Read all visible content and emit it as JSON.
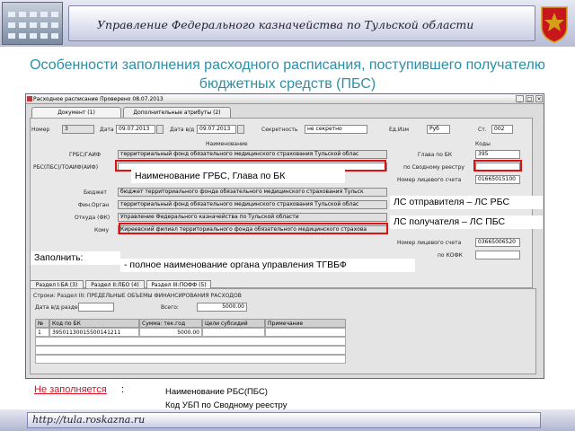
{
  "header": {
    "org_title": "Управление Федерального казначейства по Тульской области"
  },
  "slide_title": "Особенности заполнения расходного расписания, поступившего получателю бюджетных средств (ПБС)",
  "window": {
    "title": "Расходное расписание Проверено 08.07.2013",
    "tabs": [
      "Документ (1)",
      "Дополнительные атрибуты (2)"
    ],
    "labels": {
      "number": "Номер",
      "date": "Дата",
      "date_bd": "Дата в/д",
      "secrecy": "Секретность",
      "unit": "Ед.Изм",
      "page": "Ст.",
      "naimenovanie": "Наименование",
      "codes": "Коды",
      "grbs": "ГРБС/ГАИФ",
      "rbs": "РБС(ПБС)/ТОАИФ(АИФ)",
      "budget": "Бюджет",
      "fin_organ": "Фин.Орган",
      "otkuda": "Откуда (ФК)",
      "komu": "Кому",
      "glava": "Глава по БК",
      "po_svod": "по Сводному реестру",
      "nomer_ls": "Номер лицевого счета",
      "po_kofk": "по КОФК"
    },
    "values": {
      "number": "3",
      "date": "09.07.2013",
      "date_bd": "09.07.2013",
      "secrecy": "не секретно",
      "unit": "Руб",
      "page": "002",
      "grbs": "территориальный фонд обязательного медицинского страхования Тульской облас",
      "budget": "бюджет территориального фонда обязательного медицинского страхования Тульск",
      "fin_organ": "территориальный фонд обязательного медицинского страхования Тульской облас",
      "otkuda": "Управление Федерального казначейства по Тульской области",
      "komu": "Киреевский филиал территориального фонда обязательного медицинского страхова",
      "glava": "395",
      "nomer_ls1": "01665015100",
      "nomer_ls2": "03665006520"
    },
    "grid_tabs": [
      "Раздел I:БА (3)",
      "Раздел II:ЛБО (4)",
      "Раздел III:ПОФФ (5)"
    ],
    "grid_caption": "Строки: Раздел III: ПРЕДЕЛЬНЫЕ ОБЪЕМЫ ФИНАНСИРОВАНИЯ РАСХОДОВ",
    "grid_date_label": "Дата в/д раздела",
    "grid_total_label": "Всего:",
    "grid_total_value": "5000.00",
    "grid_headers": [
      "№",
      "Код по БК",
      "Сумма: тек.год",
      "Цели субсидий",
      "Примечание"
    ],
    "grid_rows": [
      {
        "n": "1",
        "kbk": "39501130015500141211",
        "sum": "5000.00"
      }
    ]
  },
  "callouts": {
    "grbs_name": "Наименование ГРБС, Глава по БК",
    "ls_sender": "ЛС отправителя – ЛС РБС",
    "ls_receiver": "ЛС получателя – ЛС ПБС",
    "fill": "Заполнить:",
    "komu_hint": "- полное наименование органа управления ТГВБФ"
  },
  "bottom": {
    "not_filled": "Не заполняется",
    "colon": ":",
    "line1": "Наименование РБС(ПБС)",
    "line2": "Код УБП  по Сводному реестру"
  },
  "footer": {
    "url": "http://tula.roskazna.ru"
  },
  "colors": {
    "title": "#2b8fa8",
    "red": "#d11"
  }
}
